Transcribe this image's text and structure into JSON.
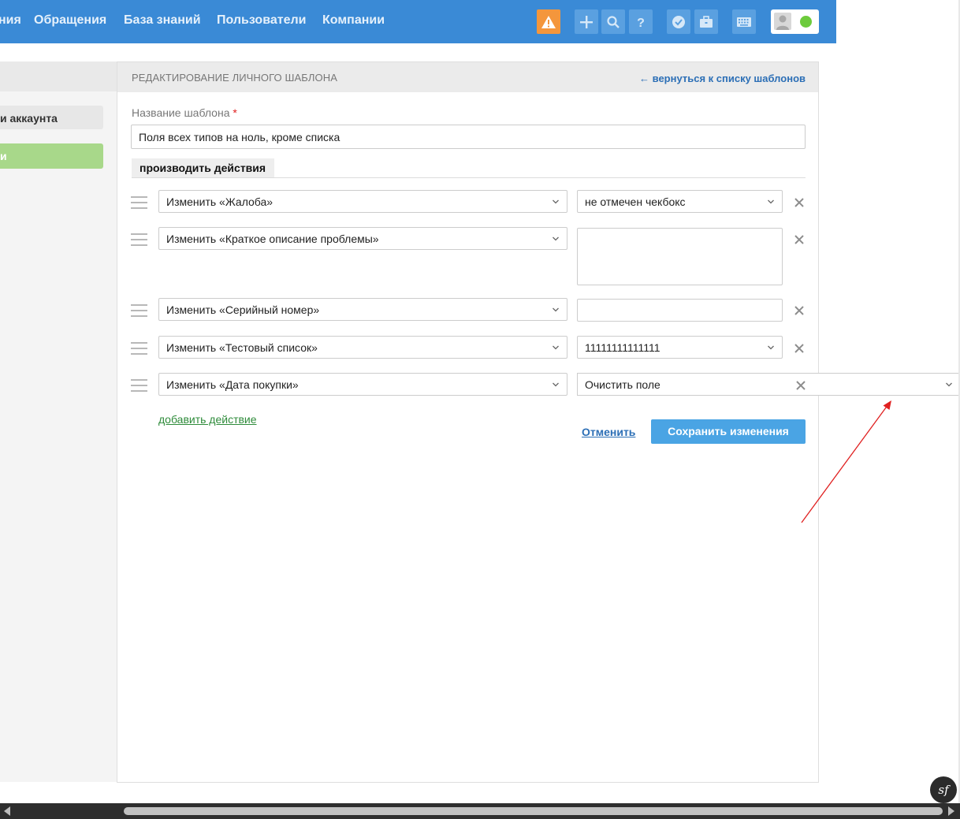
{
  "nav": {
    "items": [
      "ния",
      "Обращения",
      "База знаний",
      "Пользователи",
      "Компании"
    ]
  },
  "toolbar_icons": [
    "warning-icon",
    "plus-icon",
    "search-icon",
    "help-icon",
    "shield-check-icon",
    "briefcase-icon",
    "keyboard-icon",
    "user-icon"
  ],
  "sidebar": {
    "item_account": "и аккаунта",
    "item_active": "и"
  },
  "panel": {
    "title": "РЕДАКТИРОВАНИЕ ЛИЧНОГО ШАБЛОНА",
    "back_link": "← вернуться к списку шаблонов",
    "name_label": "Название шаблона",
    "name_required_mark": "*",
    "name_value": "Поля всех типов на ноль, кроме списка",
    "section_tab": "производить действия"
  },
  "actions": [
    {
      "field": "Изменить «Жалоба»",
      "value": "не отмечен чекбокс",
      "value_type": "select"
    },
    {
      "field": "Изменить «Краткое описание проблемы»",
      "value": "",
      "value_type": "textarea"
    },
    {
      "field": "Изменить «Серийный номер»",
      "value": "",
      "value_type": "text"
    },
    {
      "field": "Изменить «Тестовый список»",
      "value": "11111111111111",
      "value_type": "select"
    },
    {
      "field": "Изменить «Дата покупки»",
      "value": "Очистить поле",
      "value_type": "select-overflow"
    }
  ],
  "buttons": {
    "add_action": "добавить действие",
    "cancel": "Отменить",
    "save": "Сохранить изменения"
  },
  "colors": {
    "topbar": "#3a8ad6",
    "accent_blue": "#4aa4e4",
    "link_green": "#2e8b3a",
    "warning": "#f4963c",
    "status_online": "#6dcb3c",
    "annotation_arrow": "#e02020"
  },
  "badge": {
    "text": "sf"
  }
}
